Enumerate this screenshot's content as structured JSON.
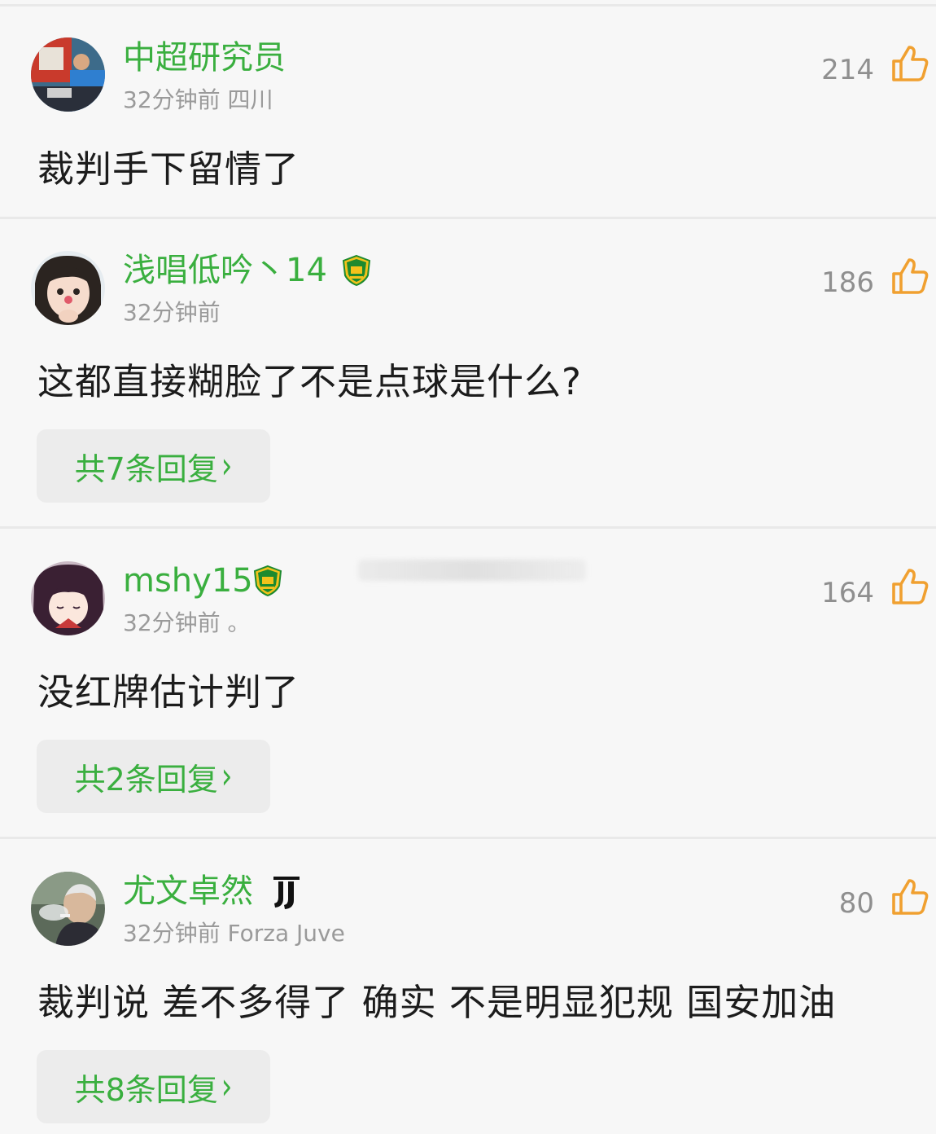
{
  "comments": [
    {
      "username": "中超研究员",
      "time": "32分钟前",
      "location": "四川",
      "likes": "214",
      "text": "裁判手下留情了",
      "replies": ""
    },
    {
      "username": "浅唱低吟丶14",
      "time": "32分钟前",
      "location": "",
      "likes": "186",
      "text": "这都直接糊脸了不是点球是什么?",
      "replies": "共7条回复"
    },
    {
      "username": "mshy15",
      "time": "32分钟前",
      "location": "。",
      "likes": "164",
      "text": "没红牌估计判了",
      "replies": "共2条回复"
    },
    {
      "username": "尤文卓然",
      "time": "32分钟前",
      "location": "Forza Juve",
      "likes": "80",
      "text": "裁判说 差不多得了 确实 不是明显犯规 国安加油",
      "replies": "共8条回复"
    }
  ],
  "icons": {
    "like": "thumbs-up-icon",
    "badge": "beijing-guoan-badge-icon",
    "juve": "juventus-logo-icon",
    "chevron": "chevron-right-icon"
  },
  "colors": {
    "username": "#3aaf3f",
    "like_icon": "#f0a030",
    "meta": "#9a9a9a",
    "background": "#f7f7f7"
  }
}
